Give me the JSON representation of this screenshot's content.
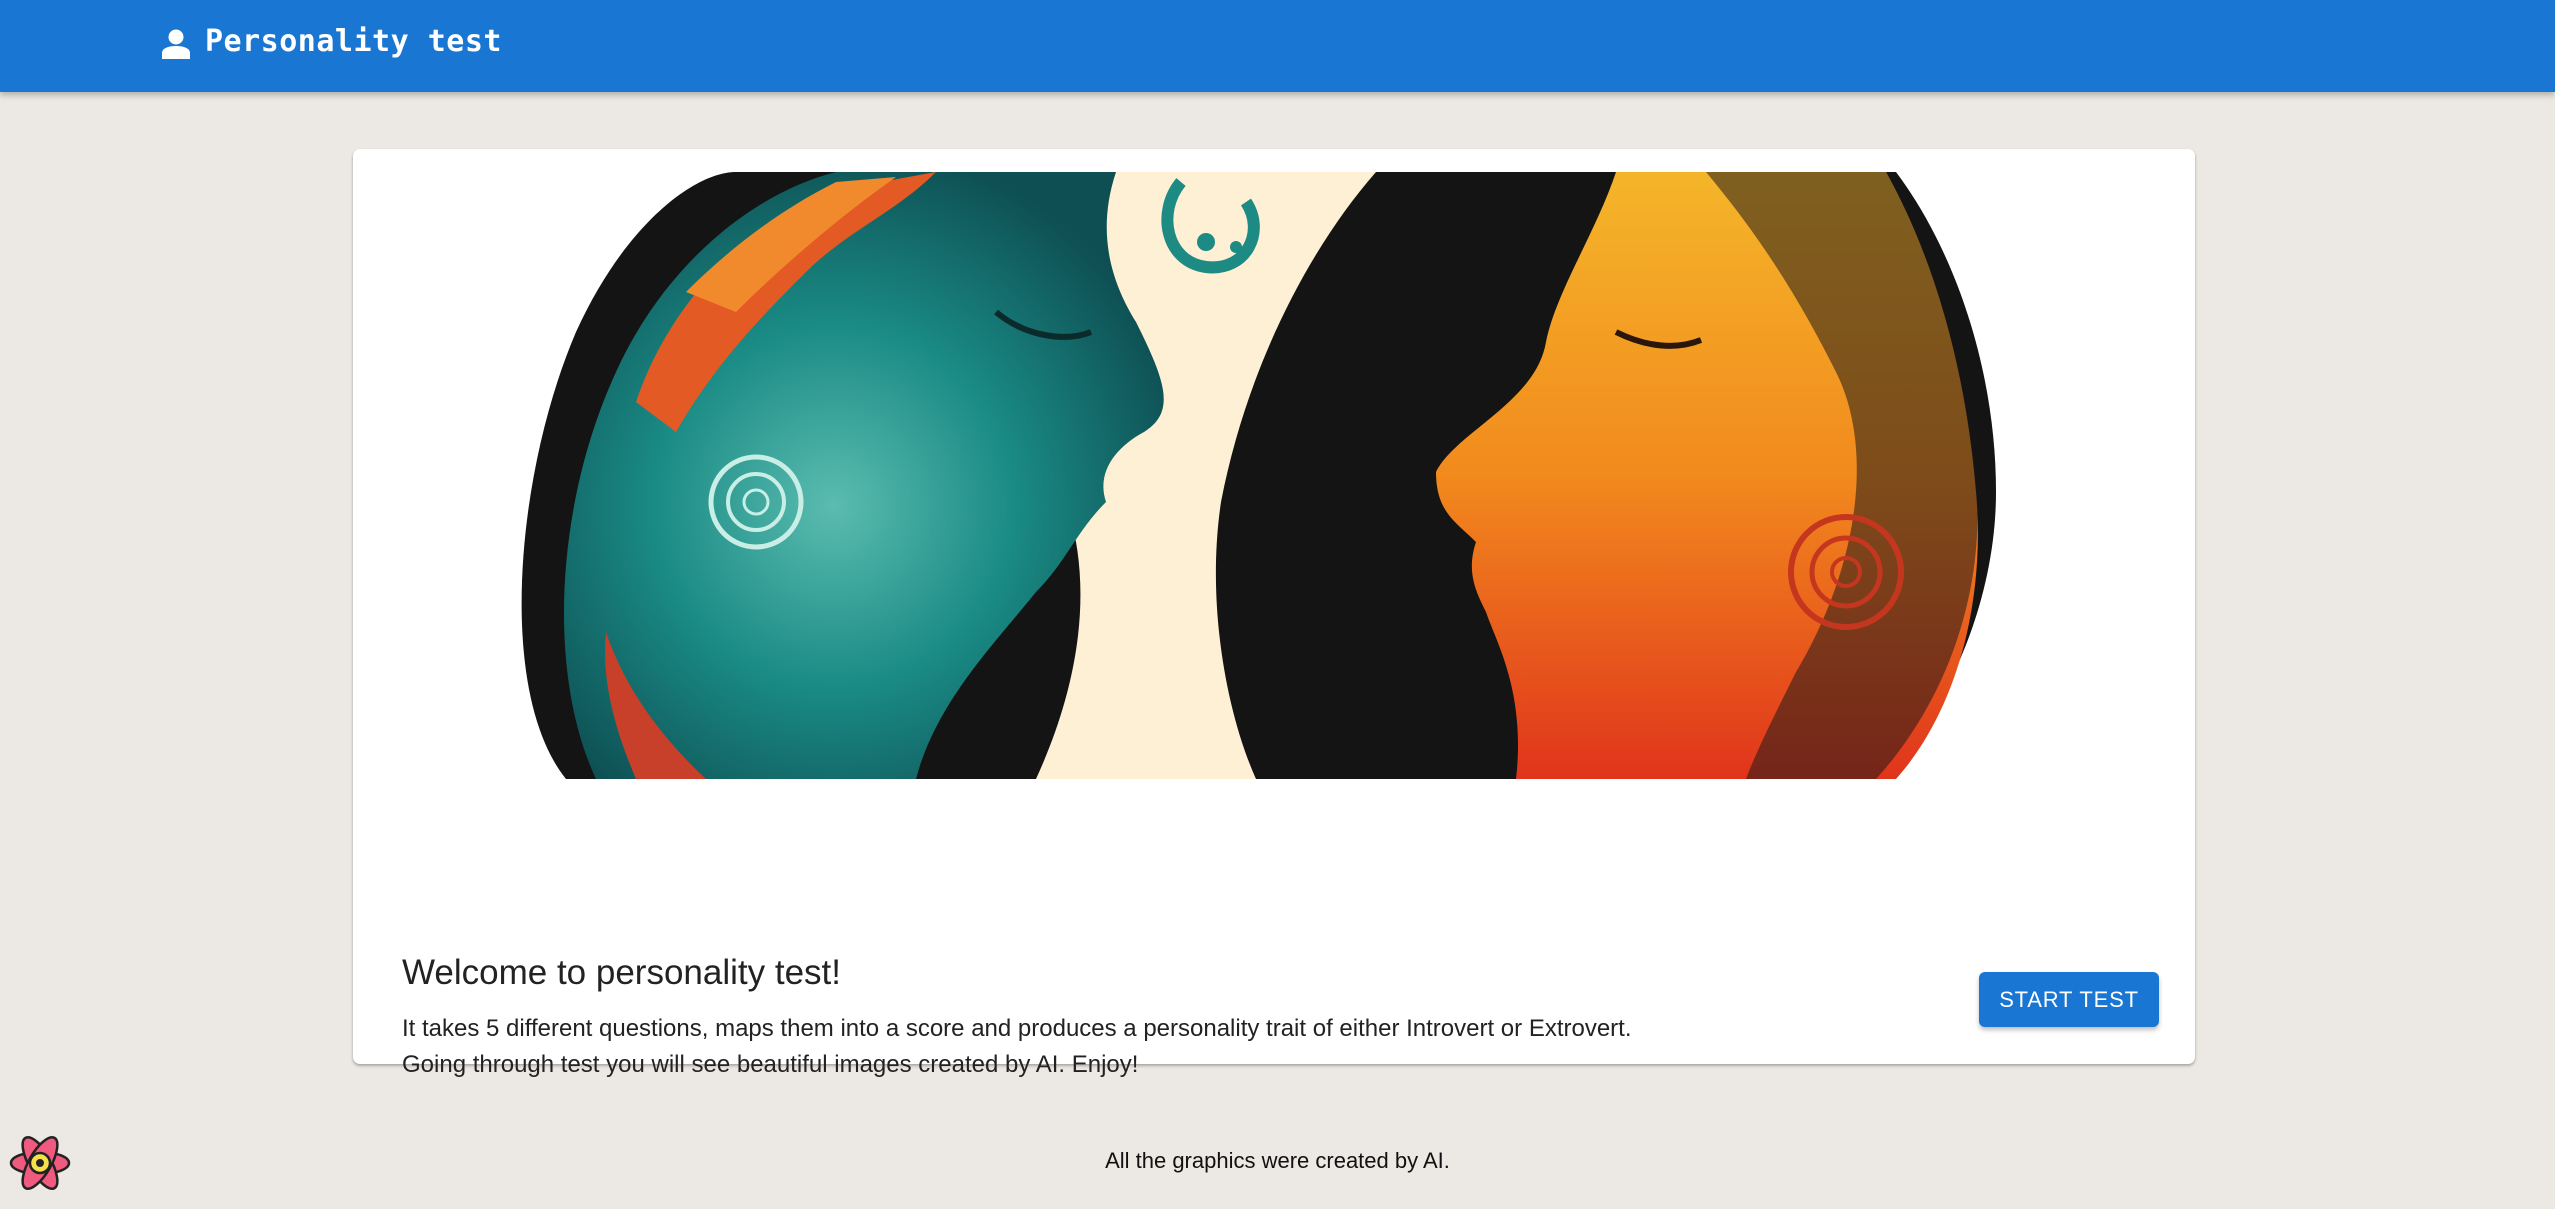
{
  "appbar": {
    "title": "Personality test",
    "icon": "user-icon"
  },
  "card": {
    "image": {
      "icon": "two-faces-illustration"
    },
    "title": "Welcome to personality test!",
    "line1": "It takes 5 different questions, maps them into a score and produces a personality trait of either Introvert or Extrovert.",
    "line2": "Going through test you will see beautiful images created by AI. Enjoy!",
    "start_label": "START TEST"
  },
  "footer": {
    "text": "All the graphics were created by AI."
  },
  "colors": {
    "primary": "#1976d2",
    "background": "#ece8e3",
    "card": "#ffffff"
  },
  "corner_icon": "react-logo-icon"
}
